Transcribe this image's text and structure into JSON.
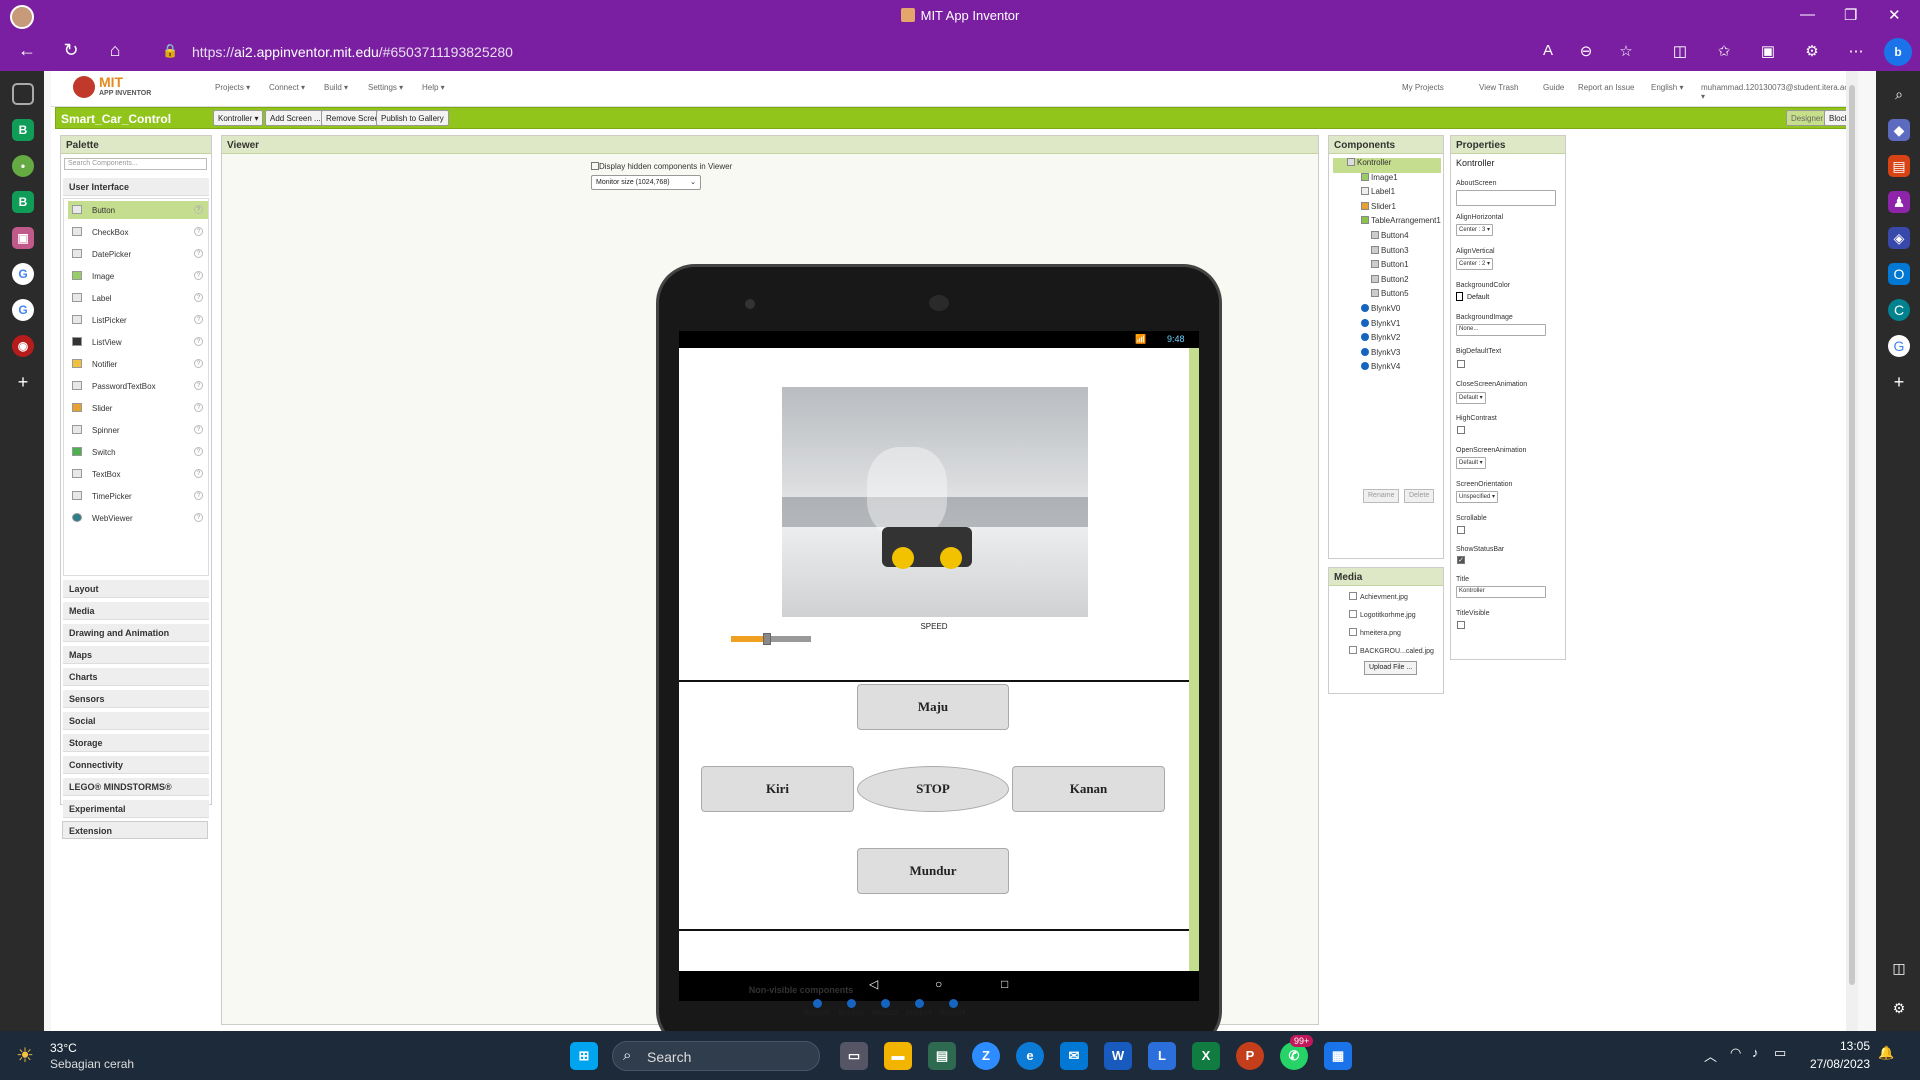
{
  "window": {
    "title": "MIT App Inventor",
    "minimize": "—",
    "maximize": "❐",
    "close": "✕"
  },
  "browser": {
    "url_prefix": "https://",
    "url_domain": "ai2.appinventor.mit.edu",
    "url_path": "/#6503711193825280"
  },
  "app": {
    "logo_text": "MIT",
    "logo_sub": "APP INVENTOR",
    "menus": [
      "Projects ▾",
      "Connect ▾",
      "Build ▾",
      "Settings ▾",
      "Help ▾"
    ],
    "right_links": [
      "My Projects",
      "View Trash",
      "Guide",
      "Report an Issue",
      "English ▾",
      "muhammad.120130073@student.itera.ac.id ▾"
    ]
  },
  "project": {
    "name": "Smart_Car_Control",
    "buttons": [
      "Kontroller ▾",
      "Add Screen ...",
      "Remove Screen",
      "Publish to Gallery"
    ],
    "mode_buttons": [
      "Designer",
      "Blocks"
    ]
  },
  "palette": {
    "title": "Palette",
    "search_placeholder": "Search Components...",
    "open_category": "User Interface",
    "items": [
      "Button",
      "CheckBox",
      "DatePicker",
      "Image",
      "Label",
      "ListPicker",
      "ListView",
      "Notifier",
      "PasswordTextBox",
      "Slider",
      "Spinner",
      "Switch",
      "TextBox",
      "TimePicker",
      "WebViewer"
    ],
    "categories": [
      "Layout",
      "Media",
      "Drawing and Animation",
      "Maps",
      "Charts",
      "Sensors",
      "Social",
      "Storage",
      "Connectivity",
      "LEGO® MINDSTORMS®",
      "Experimental",
      "Extension"
    ]
  },
  "viewer": {
    "title": "Viewer",
    "hidden_checkbox": "Display hidden components in Viewer",
    "size_select": "Monitor size (1024,768)",
    "status_time": "9:48",
    "speed_label": "SPEED",
    "slider_value": 0.45,
    "buttons": {
      "forward": "Maju",
      "left": "Kiri",
      "stop": "STOP",
      "right": "Kanan",
      "back": "Mundur"
    },
    "nonvisible_title": "Non-visible components",
    "nonvisible": [
      "BlynkV0",
      "BlynkV1",
      "BlynkV2",
      "BlynkV3",
      "BlynkV4"
    ]
  },
  "components": {
    "title": "Components",
    "tree": [
      {
        "name": "Kontroller",
        "level": 0,
        "type": "screen"
      },
      {
        "name": "Image1",
        "level": 1,
        "type": "image"
      },
      {
        "name": "Label1",
        "level": 1,
        "type": "label"
      },
      {
        "name": "Slider1",
        "level": 1,
        "type": "slider"
      },
      {
        "name": "TableArrangement1",
        "level": 1,
        "type": "table"
      },
      {
        "name": "Button4",
        "level": 2,
        "type": "button"
      },
      {
        "name": "Button3",
        "level": 2,
        "type": "button"
      },
      {
        "name": "Button1",
        "level": 2,
        "type": "button"
      },
      {
        "name": "Button2",
        "level": 2,
        "type": "button"
      },
      {
        "name": "Button5",
        "level": 2,
        "type": "button"
      },
      {
        "name": "BlynkV0",
        "level": 1,
        "type": "ext"
      },
      {
        "name": "BlynkV1",
        "level": 1,
        "type": "ext"
      },
      {
        "name": "BlynkV2",
        "level": 1,
        "type": "ext"
      },
      {
        "name": "BlynkV3",
        "level": 1,
        "type": "ext"
      },
      {
        "name": "BlynkV4",
        "level": 1,
        "type": "ext"
      }
    ],
    "rename": "Rename",
    "delete": "Delete"
  },
  "media": {
    "title": "Media",
    "files": [
      "Achievment.jpg",
      "Logotitkorhme.jpg",
      "hmeitera.png",
      "BACKGROU...caled.jpg"
    ],
    "upload": "Upload File ..."
  },
  "properties": {
    "title": "Properties",
    "component": "Kontroller",
    "about_screen": {
      "label": "AboutScreen",
      "value": ""
    },
    "align_horizontal": {
      "label": "AlignHorizontal",
      "value": "Center : 3 ▾"
    },
    "align_vertical": {
      "label": "AlignVertical",
      "value": "Center : 2 ▾"
    },
    "background_color": {
      "label": "BackgroundColor",
      "value": "Default"
    },
    "background_image": {
      "label": "BackgroundImage",
      "value": "None..."
    },
    "big_default_text": {
      "label": "BigDefaultText",
      "checked": false
    },
    "close_anim": {
      "label": "CloseScreenAnimation",
      "value": "Default ▾"
    },
    "high_contrast": {
      "label": "HighContrast",
      "checked": false
    },
    "open_anim": {
      "label": "OpenScreenAnimation",
      "value": "Default ▾"
    },
    "orientation": {
      "label": "ScreenOrientation",
      "value": "Unspecified ▾"
    },
    "scrollable": {
      "label": "Scrollable",
      "checked": false
    },
    "show_status": {
      "label": "ShowStatusBar",
      "checked": true
    },
    "title_prop": {
      "label": "Title",
      "value": "Kontroller"
    },
    "title_visible": {
      "label": "TitleVisible",
      "checked": false
    }
  },
  "taskbar": {
    "temp": "33°C",
    "weather": "Sebagian cerah",
    "search": "Search",
    "time": "13:05",
    "date": "27/08/2023",
    "badge": "99+"
  },
  "colors": {
    "titlebar": "#7b1fa2",
    "project_bar": "#92c51b",
    "slider": "#f0a020"
  }
}
